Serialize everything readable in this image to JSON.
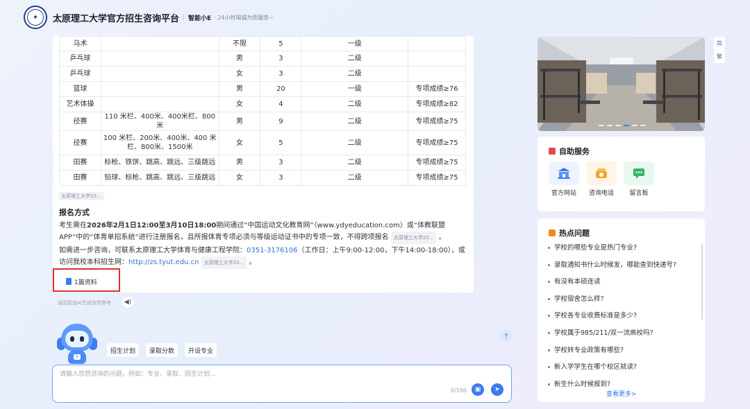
{
  "header": {
    "title": "太原理工大学官方招生咨询平台",
    "assistant_name": "智能小E",
    "tagline": "· 24小时竭诚为您服务~"
  },
  "table": {
    "rows": [
      [
        "马术",
        "",
        "不限",
        "5",
        "一级",
        ""
      ],
      [
        "乒乓球",
        "",
        "男",
        "3",
        "二级",
        ""
      ],
      [
        "乒乓球",
        "",
        "女",
        "3",
        "二级",
        ""
      ],
      [
        "篮球",
        "",
        "男",
        "20",
        "一级",
        "专项成绩≥76"
      ],
      [
        "艺术体操",
        "",
        "女",
        "4",
        "二级",
        "专项成绩≥82"
      ],
      [
        "径赛",
        "110 米栏、400米、400米栏、800米",
        "男",
        "9",
        "二级",
        "专项成绩≥75"
      ],
      [
        "径赛",
        "100 米栏、200米、400米、400 米栏、800米、1500米",
        "女",
        "5",
        "二级",
        "专项成绩≥75"
      ],
      [
        "田赛",
        "标枪、铁饼、跳高、跳远、三级跳远",
        "男",
        "3",
        "二级",
        "专项成绩≥75"
      ],
      [
        "田赛",
        "铅球、标枪、跳高、跳远、三级跳远",
        "女",
        "3",
        "二级",
        "专项成绩≥75"
      ]
    ]
  },
  "answer": {
    "source_tag": "太原理工大学20...",
    "section_title": "报名方式",
    "p1_a": "考生需在",
    "p1_bold": "2026年2月1日12:00至3月10日18:00",
    "p1_b": "期间通过“中国运动文化教育网”（www.ydyeducation.com）或“体教联盟APP”中的“体育单招系统”进行注册报名，且所报体育专项必须与等级运动证书中的专项一致，不得跨项报名",
    "p1_end": "。",
    "p2_a": "如需进一步咨询，可联系太原理工大学体育与健康工程学院：",
    "p2_phone": "0351-3176106",
    "p2_b": "（工作日：上午9:00-12:00，下午14:00-18:00），或访问我校本科招生网：",
    "p2_link": "http://zs.tyut.edu.cn",
    "p2_end": "。",
    "references_label": "1篇资料",
    "disclaimer": "该回复由AI生成仅供参考"
  },
  "quick_actions": [
    "招生计划",
    "录取分数",
    "开设专业"
  ],
  "input": {
    "placeholder": "请输入您想咨询的问题，例如：专业、录取、招生计划...",
    "counter": "0/100"
  },
  "lang_toggle": [
    "简",
    "繁"
  ],
  "self_service": {
    "title": "自助服务",
    "items": [
      {
        "label": "官方网站",
        "icon": "school-building-icon"
      },
      {
        "label": "咨询电话",
        "icon": "phone-icon"
      },
      {
        "label": "留言板",
        "icon": "message-board-icon"
      }
    ]
  },
  "hot_questions": {
    "title": "热点问题",
    "items": [
      "学校的哪些专业是热门专业?",
      "录取通知书什么时候发，哪能查到快递号?",
      "有没有本硕连读",
      "学校宿舍怎么样?",
      "学校各专业收费标准是多少?",
      "学校属于985/211/双一流高校吗?",
      "学校转专业政策有哪些?",
      "新入学学生在哪个校区就读?",
      "新生什么时候报到?"
    ],
    "more_label": "查看更多>"
  },
  "colors": {
    "accent": "#3b7df0",
    "highlight_border": "#e0302a",
    "link": "#2f6fd6"
  }
}
